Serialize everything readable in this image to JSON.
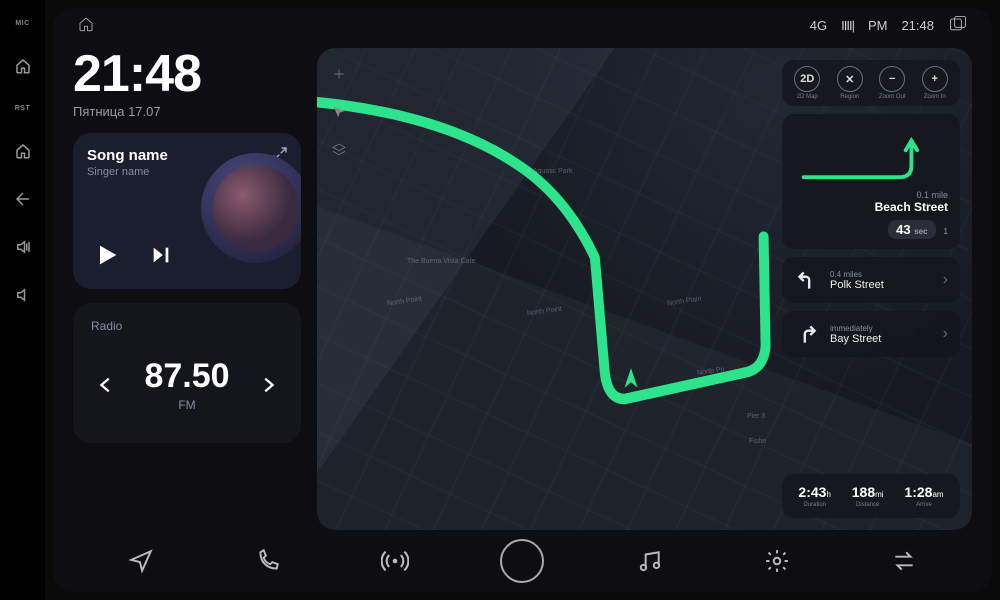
{
  "hw": {
    "mic": "MIC",
    "rst": "RST"
  },
  "status": {
    "net": "4G",
    "signal": "IIII|",
    "time_prefix": "PM",
    "time": "21:48"
  },
  "clock": {
    "time": "21:48",
    "date": "Пятница 17.07"
  },
  "music": {
    "song": "Song name",
    "artist": "Singer name"
  },
  "radio": {
    "label": "Radio",
    "freq": "87.50",
    "band": "FM"
  },
  "nav": {
    "tools": [
      {
        "glyph": "2D",
        "label": "2D Map"
      },
      {
        "glyph": "✕",
        "label": "Region"
      },
      {
        "glyph": "−",
        "label": "Zoom Out"
      },
      {
        "glyph": "+",
        "label": "Zoom In"
      }
    ],
    "primary": {
      "dist": "0.1 mile",
      "street": "Beach Street",
      "eta": "43",
      "eta_unit": "sec",
      "lane_count": "1"
    },
    "steps": [
      {
        "dist": "0.4 miles",
        "street": "Polk Street"
      },
      {
        "dist": "immediately",
        "street": "Bay Street"
      }
    ],
    "stats": [
      {
        "value": "2:43",
        "unit": "h",
        "label": "Duration"
      },
      {
        "value": "188",
        "unit": "mi",
        "label": "Distance"
      },
      {
        "value": "1:28",
        "unit": "am",
        "label": "Arrive"
      }
    ],
    "map_labels": [
      "A Aquatic Park",
      "The Buena Vista Cafe",
      "North Point",
      "North Point",
      "North Plain",
      "North Po",
      "Pier 3",
      "Fishe"
    ]
  }
}
